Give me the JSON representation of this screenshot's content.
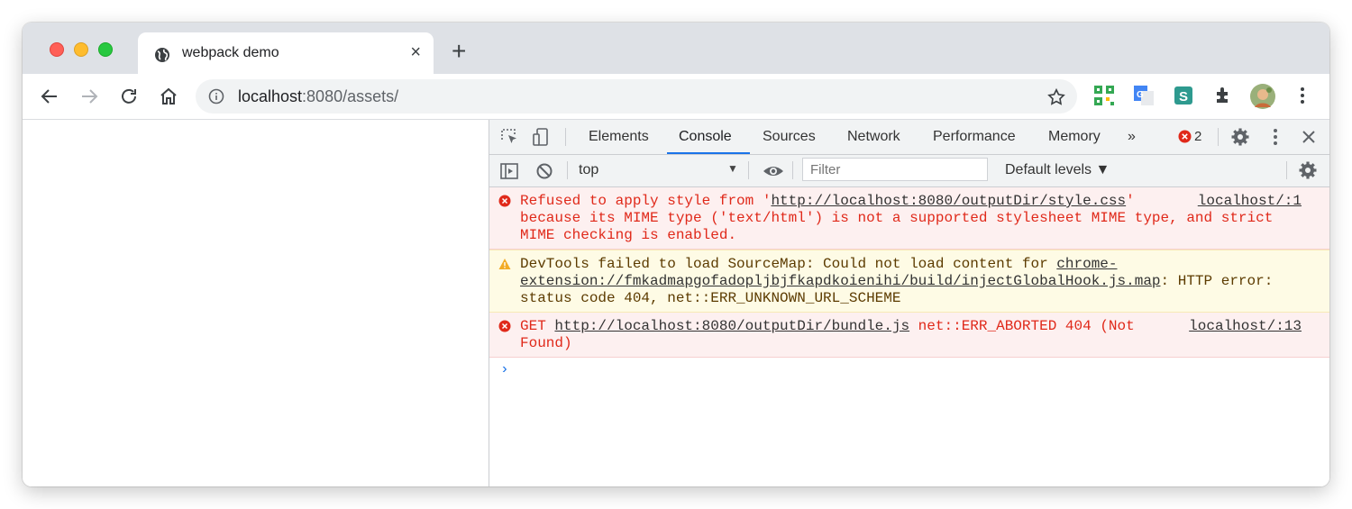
{
  "tab": {
    "title": "webpack demo",
    "close": "×",
    "new_tab": "+"
  },
  "omnibox": {
    "host": "localhost",
    "rest": ":8080/assets/"
  },
  "devtools": {
    "tabs": [
      "Elements",
      "Console",
      "Sources",
      "Network",
      "Performance",
      "Memory"
    ],
    "more": "»",
    "error_count": "2",
    "context": "top",
    "context_arrow": "▼",
    "filter_placeholder": "Filter",
    "levels": "Default levels ▼"
  },
  "console": {
    "messages": [
      {
        "type": "error",
        "pre": "Refused to apply style from '",
        "link": "http://localhost:8080/outputDir/style.css",
        "post": "' because its MIME type ('text/html') is not a supported stylesheet MIME type, and strict MIME checking is enabled.",
        "source": "localhost/:1"
      },
      {
        "type": "warning",
        "pre": "DevTools failed to load SourceMap: Could not load content for ",
        "link": "chrome-extension://fmkadmapgofadopljbjfkapdkoienihi/build/injectGlobalHook.js.map",
        "post": ": HTTP error: status code 404, net::ERR_UNKNOWN_URL_SCHEME",
        "source": ""
      },
      {
        "type": "error",
        "pre": "GET ",
        "link": "http://localhost:8080/outputDir/bundle.js",
        "post": " net::ERR_ABORTED 404 (Not Found)",
        "source": "localhost/:13"
      }
    ],
    "prompt": "›"
  },
  "colors": {
    "error": "#e0291a",
    "warning_bg": "#fefbe5",
    "error_bg": "#fdf0f0",
    "accent": "#1a73e8"
  }
}
